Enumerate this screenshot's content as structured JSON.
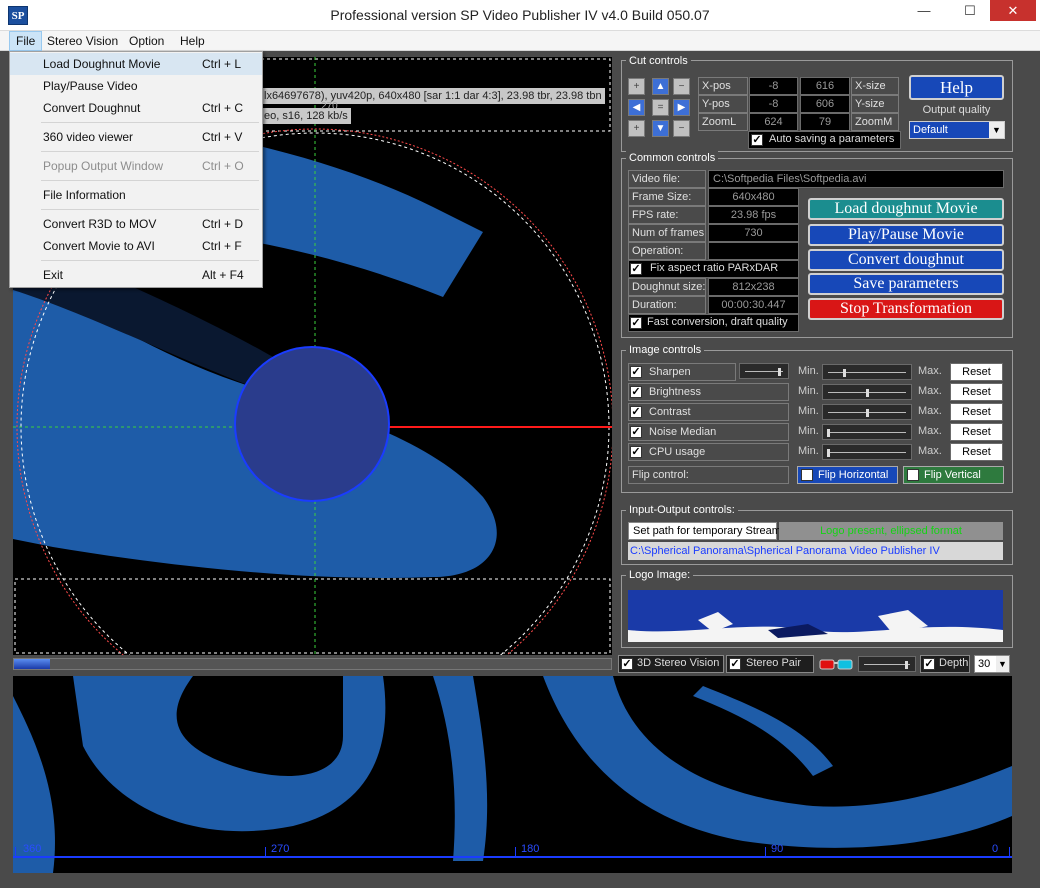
{
  "window": {
    "title": "Professional version SP Video Publisher IV  v4.0 Build 050.07",
    "icon_text": "SP",
    "controls": {
      "minimize": "—",
      "maximize": "☐",
      "close": "✕"
    }
  },
  "menubar": [
    "File",
    "Stereo Vision",
    "Option",
    "Help"
  ],
  "file_menu": [
    {
      "label": "Load Doughnut Movie",
      "shortcut": "Ctrl + L",
      "enabled": true
    },
    {
      "label": "Play/Pause Video",
      "shortcut": "",
      "enabled": true
    },
    {
      "label": "Convert Doughnut",
      "shortcut": "Ctrl + C",
      "enabled": true
    },
    {
      "label": "360 video viewer",
      "shortcut": "Ctrl + V",
      "enabled": true
    },
    {
      "label": "Popup Output Window",
      "shortcut": "Ctrl + O",
      "enabled": false
    },
    {
      "label": "File Information",
      "shortcut": "",
      "enabled": true
    },
    {
      "label": "Convert R3D to MOV",
      "shortcut": "Ctrl + D",
      "enabled": true
    },
    {
      "label": "Convert Movie to AVI",
      "shortcut": "Ctrl + F",
      "enabled": true
    },
    {
      "label": "Exit",
      "shortcut": "Alt + F4",
      "enabled": true
    }
  ],
  "video_info": {
    "line1": "lx64697678), yuv420p, 640x480 [sar 1:1 dar 4:3], 23.98 tbr, 23.98 tbn",
    "line2": "eo, s16, 128 kb/s",
    "top_mark": "270"
  },
  "cut_controls": {
    "title": "Cut controls",
    "rows": [
      {
        "label": "X-pos",
        "v1": "-8",
        "v2": "616",
        "right_label": "X-size"
      },
      {
        "label": "Y-pos",
        "v1": "-8",
        "v2": "606",
        "right_label": "Y-size"
      },
      {
        "label": "ZoomL",
        "v1": "624",
        "v2": "79",
        "right_label": "ZoomM"
      }
    ],
    "auto_save_label": "Auto saving a parameters",
    "auto_save_checked": true,
    "help_label": "Help",
    "output_quality_label": "Output quality",
    "output_quality_value": "Default"
  },
  "common_controls": {
    "title": "Common controls",
    "video_file_label": "Video file:",
    "video_file_value": "C:\\Softpedia Files\\Softpedia.avi",
    "fields": [
      {
        "label": "Frame Size:",
        "value": "640x480"
      },
      {
        "label": "FPS rate:",
        "value": "23.98 fps"
      },
      {
        "label": "Num of frames:",
        "value": "730"
      },
      {
        "label": "Operation:",
        "value": ""
      }
    ],
    "fix_aspect_label": "Fix aspect ratio PARxDAR",
    "fields2": [
      {
        "label": "Doughnut size:",
        "value": "812x238"
      },
      {
        "label": "Duration:",
        "value": "00:00:30.447"
      }
    ],
    "fast_conversion_label": "Fast conversion, draft quality",
    "buttons": {
      "load": "Load doughnut Movie",
      "play": "Play/Pause Movie",
      "convert": "Convert doughnut",
      "save": "Save parameters",
      "stop": "Stop Transformation"
    }
  },
  "image_controls": {
    "title": "Image controls",
    "rows": [
      {
        "label": "Sharpen",
        "min": "Min.",
        "max": "Max.",
        "reset": "Reset",
        "level": 0.2
      },
      {
        "label": "Brightness",
        "min": "Min.",
        "max": "Max.",
        "reset": "Reset",
        "level": 0.5
      },
      {
        "label": "Contrast",
        "min": "Min.",
        "max": "Max.",
        "reset": "Reset",
        "level": 0.5
      },
      {
        "label": "Noise Median",
        "min": "Min.",
        "max": "Max.",
        "reset": "Reset",
        "level": 0.0
      },
      {
        "label": "CPU usage",
        "min": "Min.",
        "max": "Max.",
        "reset": "Reset",
        "level": 0.0
      }
    ],
    "sharpen_preview_level": 0.9,
    "flip_label": "Flip control:",
    "flip_horizontal": "Flip Horizontal",
    "flip_vertical": "Flip Vertical"
  },
  "io_controls": {
    "title": "Input-Output controls:",
    "set_path_label": "Set path for temporary Stream",
    "status": "Logo present, ellipsed format",
    "path": "C:\\Spherical Panorama\\Spherical Panorama Video Publisher IV"
  },
  "logo_image": {
    "title": "Logo Image:"
  },
  "stereo_bar": {
    "stereo_vision": "3D Stereo Vision",
    "stereo_pair": "Stereo Pair",
    "depth": "Depth",
    "depth_value": "30",
    "depth_level": 0.92
  },
  "progress": {
    "value": 0.06
  },
  "ruler": {
    "labels": [
      "360",
      "270",
      "180",
      "90",
      "0"
    ]
  },
  "colors": {
    "bg": "#4a4a4a",
    "video_blue": "#1e5ca8",
    "accent_blue": "#1748b8",
    "teal": "#1b8d8f",
    "red": "#d91616"
  }
}
